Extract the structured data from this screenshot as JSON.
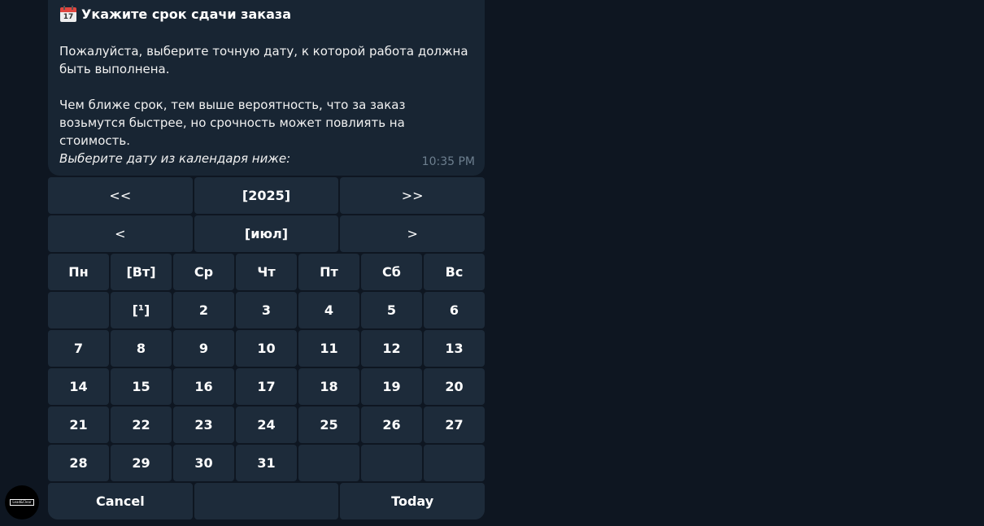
{
  "message": {
    "title": "Укажите срок сдачи заказа",
    "title_icon": "calendar-icon",
    "calendar_icon_day": "17",
    "paragraph1": "Пожалуйста, выберите точную дату, к которой работа должна быть выполнена.",
    "paragraph2": "Чем ближе срок, тем выше вероятность, что за заказ возьмутся быстрее, но срочность может повлиять на стоимость.",
    "paragraph3": "Выберите дату из календаря ниже:",
    "time": "10:35 PM"
  },
  "keyboard": {
    "year_row": {
      "prev": "<<",
      "current": "[2025]",
      "next": ">>"
    },
    "month_row": {
      "prev": "<",
      "current": "[июл]",
      "next": ">"
    },
    "weekdays": [
      "Пн",
      "[Вт]",
      "Ср",
      "Чт",
      "Пт",
      "Сб",
      "Вс"
    ],
    "weeks": [
      [
        "",
        "[¹]",
        "2",
        "3",
        "4",
        "5",
        "6"
      ],
      [
        "7",
        "8",
        "9",
        "10",
        "11",
        "12",
        "13"
      ],
      [
        "14",
        "15",
        "16",
        "17",
        "18",
        "19",
        "20"
      ],
      [
        "21",
        "22",
        "23",
        "24",
        "25",
        "26",
        "27"
      ],
      [
        "28",
        "29",
        "30",
        "31",
        "",
        "",
        ""
      ]
    ],
    "footer": {
      "cancel": "Cancel",
      "middle": "",
      "today": "Today"
    }
  },
  "avatar": {
    "logo_text": "Lead&Clear"
  },
  "colors": {
    "background": "#0e1621",
    "bubble": "#182533",
    "button": "#1d2b3a",
    "time": "#6d7f8f"
  }
}
